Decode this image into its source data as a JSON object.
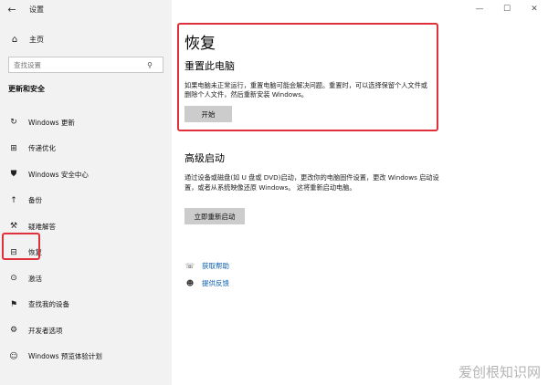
{
  "window": {
    "title": "设置",
    "controls": {
      "minimize": "—",
      "maximize": "☐",
      "close": "✕"
    }
  },
  "sidebar": {
    "back_glyph": "←",
    "home_label": "主页",
    "search_placeholder": "查找设置",
    "section_title": "更新和安全",
    "items": [
      {
        "label": "Windows 更新",
        "icon": "refresh-icon"
      },
      {
        "label": "传递优化",
        "icon": "delivery-icon"
      },
      {
        "label": "Windows 安全中心",
        "icon": "shield-icon"
      },
      {
        "label": "备份",
        "icon": "backup-icon"
      },
      {
        "label": "疑难解答",
        "icon": "wrench-icon"
      },
      {
        "label": "恢复",
        "icon": "recovery-icon",
        "active": true
      },
      {
        "label": "激活",
        "icon": "activation-icon"
      },
      {
        "label": "查找我的设备",
        "icon": "find-device-icon"
      },
      {
        "label": "开发者选项",
        "icon": "developer-icon"
      },
      {
        "label": "Windows 预览体验计划",
        "icon": "insider-icon"
      }
    ]
  },
  "main": {
    "page_title": "恢复",
    "reset": {
      "heading": "重置此电脑",
      "description": "如果电脑未正常运行，重置电脑可能会解决问题。重置时，可以选择保留个人文件或删除个人文件，然后重新安装 Windows。",
      "button": "开始"
    },
    "advanced": {
      "heading": "高级启动",
      "description": "通过设备或磁盘(如 U 盘或 DVD)启动，更改你的电脑固件设置，更改 Windows 启动设置，或者从系统映像还原 Windows。 这将重新启动电脑。",
      "button": "立即重新启动"
    },
    "links": {
      "help": "获取帮助",
      "feedback": "提供反馈"
    }
  },
  "watermark": "爱创根知识网",
  "colors": {
    "highlight": "#e0303c",
    "link": "#0a5fb0",
    "sidebar_bg": "#f2f2f2"
  }
}
